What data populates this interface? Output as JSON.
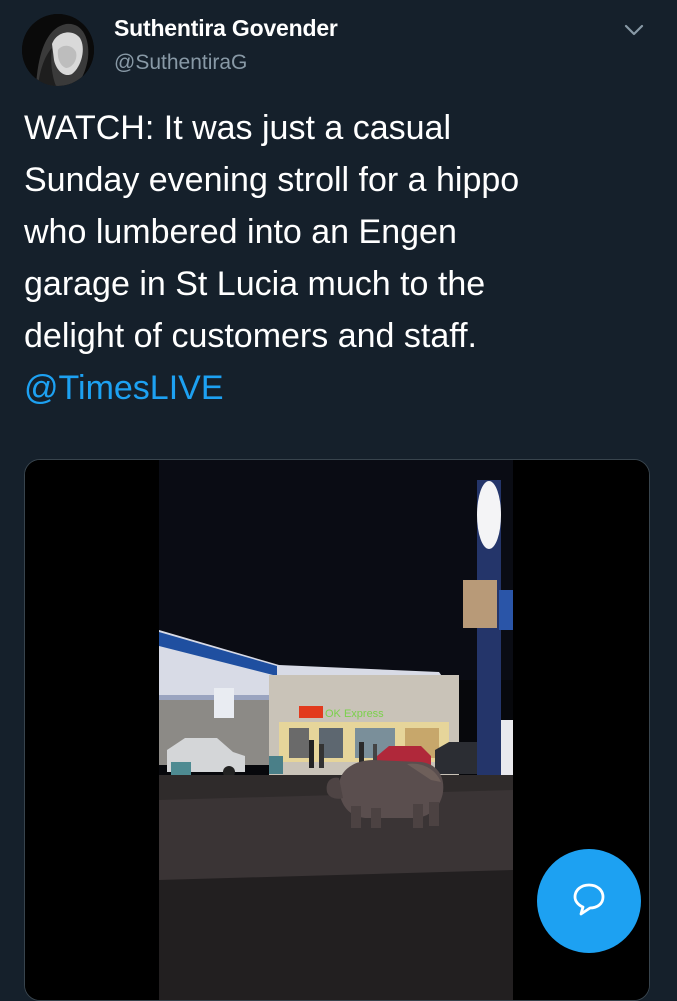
{
  "tweet": {
    "author_name": "Suthentira Govender",
    "author_handle": "@SuthentiraG",
    "text_lines": [
      "WATCH: It was just a casual",
      "Sunday evening stroll for a hippo",
      "who lumbered into an Engen",
      "garage in St Lucia much to the",
      "delight of customers and staff."
    ],
    "mention": "@TimesLIVE"
  },
  "media": {
    "store_sign": "OK Express"
  },
  "icons": {
    "more_options": "chevron-down-icon",
    "compose": "reply-bubble-icon"
  },
  "colors": {
    "background": "#15202b",
    "accent": "#1da1f2",
    "secondary_text": "#8899a6"
  }
}
